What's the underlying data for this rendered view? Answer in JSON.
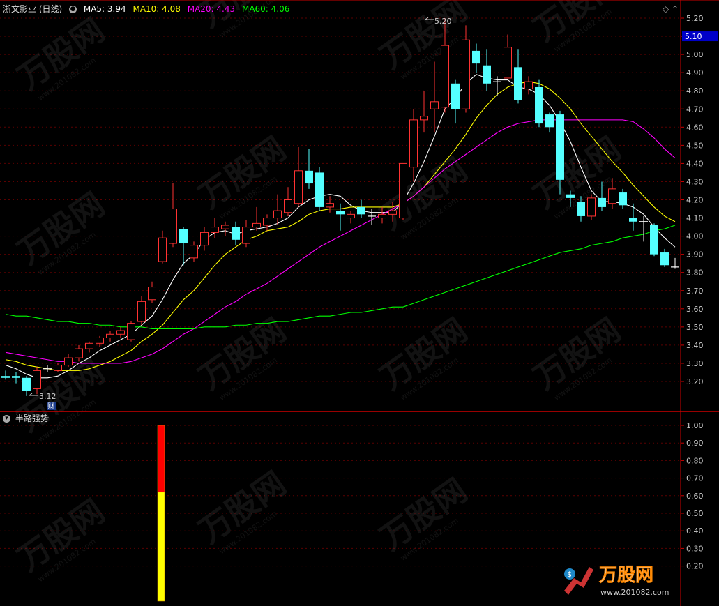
{
  "header": {
    "stock_title": "浙文影业 (日线)",
    "ma5_label": "MA5:",
    "ma5_value": "3.94",
    "ma10_label": "MA10:",
    "ma10_value": "4.08",
    "ma20_label": "MA20:",
    "ma20_value": "4.43",
    "ma60_label": "MA60:",
    "ma60_value": "4.06",
    "colors": {
      "ma5": "#ffffff",
      "ma10": "#ffff00",
      "ma20": "#ff00ff",
      "ma60": "#00ff00"
    }
  },
  "sub_panel": {
    "title": "半路强势"
  },
  "current_price_tag": "5.10",
  "watermark": {
    "brand": "万股网",
    "url": "www.201082.com"
  },
  "chart_data": [
    {
      "type": "candlestick",
      "price_axis": {
        "min": 3.12,
        "max": 5.22,
        "ticks": [
          "5.20",
          "5.10",
          "5.00",
          "4.90",
          "4.80",
          "4.70",
          "4.60",
          "4.50",
          "4.40",
          "4.30",
          "4.20",
          "4.10",
          "4.00",
          "3.90",
          "3.80",
          "3.70",
          "3.60",
          "3.50",
          "3.40",
          "3.30",
          "3.20"
        ]
      },
      "annotations": {
        "high": "5.20",
        "low": "3.12",
        "finance_marker": "财"
      },
      "candles": [
        {
          "o": 3.23,
          "h": 3.26,
          "l": 3.21,
          "c": 3.22
        },
        {
          "o": 3.23,
          "h": 3.25,
          "l": 3.19,
          "c": 3.22
        },
        {
          "o": 3.22,
          "h": 3.23,
          "l": 3.12,
          "c": 3.15
        },
        {
          "o": 3.16,
          "h": 3.28,
          "l": 3.13,
          "c": 3.26
        },
        {
          "o": 3.27,
          "h": 3.29,
          "l": 3.25,
          "c": 3.27
        },
        {
          "o": 3.26,
          "h": 3.3,
          "l": 3.25,
          "c": 3.29
        },
        {
          "o": 3.29,
          "h": 3.35,
          "l": 3.28,
          "c": 3.33
        },
        {
          "o": 3.33,
          "h": 3.4,
          "l": 3.31,
          "c": 3.38
        },
        {
          "o": 3.38,
          "h": 3.42,
          "l": 3.36,
          "c": 3.41
        },
        {
          "o": 3.41,
          "h": 3.45,
          "l": 3.39,
          "c": 3.44
        },
        {
          "o": 3.44,
          "h": 3.48,
          "l": 3.42,
          "c": 3.46
        },
        {
          "o": 3.46,
          "h": 3.5,
          "l": 3.44,
          "c": 3.48
        },
        {
          "o": 3.43,
          "h": 3.53,
          "l": 3.42,
          "c": 3.52
        },
        {
          "o": 3.53,
          "h": 3.67,
          "l": 3.51,
          "c": 3.64
        },
        {
          "o": 3.65,
          "h": 3.75,
          "l": 3.63,
          "c": 3.72
        },
        {
          "o": 3.86,
          "h": 4.03,
          "l": 3.85,
          "c": 3.99
        },
        {
          "o": 3.96,
          "h": 4.29,
          "l": 3.94,
          "c": 4.15
        },
        {
          "o": 4.04,
          "h": 4.05,
          "l": 3.84,
          "c": 3.96
        },
        {
          "o": 3.88,
          "h": 3.97,
          "l": 3.86,
          "c": 3.95
        },
        {
          "o": 3.95,
          "h": 4.05,
          "l": 3.92,
          "c": 4.02
        },
        {
          "o": 4.02,
          "h": 4.1,
          "l": 3.99,
          "c": 4.05
        },
        {
          "o": 4.04,
          "h": 4.08,
          "l": 4.0,
          "c": 4.06
        },
        {
          "o": 4.05,
          "h": 4.08,
          "l": 3.95,
          "c": 3.98
        },
        {
          "o": 3.96,
          "h": 4.09,
          "l": 3.94,
          "c": 4.05
        },
        {
          "o": 4.05,
          "h": 4.16,
          "l": 4.03,
          "c": 4.07
        },
        {
          "o": 4.06,
          "h": 4.12,
          "l": 4.03,
          "c": 4.1
        },
        {
          "o": 4.1,
          "h": 4.23,
          "l": 4.06,
          "c": 4.14
        },
        {
          "o": 4.13,
          "h": 4.27,
          "l": 4.11,
          "c": 4.2
        },
        {
          "o": 4.18,
          "h": 4.49,
          "l": 4.16,
          "c": 4.36
        },
        {
          "o": 4.36,
          "h": 4.48,
          "l": 4.26,
          "c": 4.29
        },
        {
          "o": 4.35,
          "h": 4.38,
          "l": 4.14,
          "c": 4.16
        },
        {
          "o": 4.16,
          "h": 4.22,
          "l": 4.13,
          "c": 4.18
        },
        {
          "o": 4.14,
          "h": 4.18,
          "l": 4.03,
          "c": 4.12
        },
        {
          "o": 4.1,
          "h": 4.14,
          "l": 4.07,
          "c": 4.12
        },
        {
          "o": 4.16,
          "h": 4.2,
          "l": 4.1,
          "c": 4.12
        },
        {
          "o": 4.11,
          "h": 4.15,
          "l": 4.06,
          "c": 4.11
        },
        {
          "o": 4.1,
          "h": 4.16,
          "l": 4.07,
          "c": 4.12
        },
        {
          "o": 4.12,
          "h": 4.19,
          "l": 4.08,
          "c": 4.14
        },
        {
          "o": 4.1,
          "h": 4.4,
          "l": 4.09,
          "c": 4.4
        },
        {
          "o": 4.38,
          "h": 4.7,
          "l": 4.3,
          "c": 4.64
        },
        {
          "o": 4.64,
          "h": 4.8,
          "l": 4.57,
          "c": 4.66
        },
        {
          "o": 4.7,
          "h": 4.96,
          "l": 4.57,
          "c": 4.74
        },
        {
          "o": 4.71,
          "h": 5.2,
          "l": 4.68,
          "c": 5.05
        },
        {
          "o": 4.84,
          "h": 4.86,
          "l": 4.62,
          "c": 4.7
        },
        {
          "o": 4.7,
          "h": 5.16,
          "l": 4.68,
          "c": 5.08
        },
        {
          "o": 5.02,
          "h": 5.06,
          "l": 4.9,
          "c": 4.95
        },
        {
          "o": 4.94,
          "h": 5.03,
          "l": 4.8,
          "c": 4.84
        },
        {
          "o": 4.85,
          "h": 4.88,
          "l": 4.77,
          "c": 4.85
        },
        {
          "o": 4.87,
          "h": 5.11,
          "l": 4.87,
          "c": 5.04
        },
        {
          "o": 4.93,
          "h": 5.03,
          "l": 4.73,
          "c": 4.75
        },
        {
          "o": 4.81,
          "h": 4.88,
          "l": 4.78,
          "c": 4.85
        },
        {
          "o": 4.82,
          "h": 4.86,
          "l": 4.6,
          "c": 4.62
        },
        {
          "o": 4.67,
          "h": 4.68,
          "l": 4.57,
          "c": 4.6
        },
        {
          "o": 4.67,
          "h": 4.69,
          "l": 4.23,
          "c": 4.31
        },
        {
          "o": 4.23,
          "h": 4.25,
          "l": 4.16,
          "c": 4.21
        },
        {
          "o": 4.19,
          "h": 4.22,
          "l": 4.08,
          "c": 4.11
        },
        {
          "o": 4.11,
          "h": 4.23,
          "l": 4.09,
          "c": 4.21
        },
        {
          "o": 4.21,
          "h": 4.3,
          "l": 4.14,
          "c": 4.16
        },
        {
          "o": 4.18,
          "h": 4.32,
          "l": 4.15,
          "c": 4.26
        },
        {
          "o": 4.24,
          "h": 4.26,
          "l": 4.15,
          "c": 4.17
        },
        {
          "o": 4.1,
          "h": 4.18,
          "l": 4.03,
          "c": 4.08
        },
        {
          "o": 4.08,
          "h": 4.11,
          "l": 3.97,
          "c": 4.08
        },
        {
          "o": 4.06,
          "h": 4.07,
          "l": 3.89,
          "c": 3.9
        },
        {
          "o": 3.91,
          "h": 3.93,
          "l": 3.83,
          "c": 3.84
        },
        {
          "o": 3.83,
          "h": 3.88,
          "l": 3.82,
          "c": 3.83
        }
      ],
      "ma_lines": [
        {
          "name": "MA5",
          "color": "#ffffff",
          "values": [
            3.29,
            3.27,
            3.24,
            3.22,
            3.22,
            3.23,
            3.26,
            3.3,
            3.33,
            3.37,
            3.4,
            3.43,
            3.46,
            3.51,
            3.56,
            3.65,
            3.76,
            3.85,
            3.9,
            3.98,
            4.02,
            4.03,
            4.01,
            4.03,
            4.04,
            4.05,
            4.07,
            4.1,
            4.16,
            4.2,
            4.22,
            4.23,
            4.22,
            4.17,
            4.14,
            4.13,
            4.13,
            4.13,
            4.19,
            4.29,
            4.41,
            4.55,
            4.7,
            4.76,
            4.84,
            4.89,
            4.87,
            4.86,
            4.86,
            4.82,
            4.81,
            4.78,
            4.72,
            4.63,
            4.52,
            4.38,
            4.25,
            4.19,
            4.19,
            4.18,
            4.16,
            4.12,
            4.05,
            3.99,
            3.94
          ]
        },
        {
          "name": "MA10",
          "color": "#ffff00",
          "values": [
            3.32,
            3.31,
            3.29,
            3.28,
            3.27,
            3.26,
            3.26,
            3.26,
            3.27,
            3.29,
            3.31,
            3.34,
            3.37,
            3.42,
            3.46,
            3.51,
            3.58,
            3.65,
            3.7,
            3.77,
            3.84,
            3.9,
            3.94,
            3.98,
            4.0,
            4.03,
            4.04,
            4.05,
            4.08,
            4.12,
            4.14,
            4.15,
            4.15,
            4.16,
            4.16,
            4.16,
            4.16,
            4.16,
            4.18,
            4.22,
            4.27,
            4.34,
            4.41,
            4.48,
            4.56,
            4.65,
            4.72,
            4.78,
            4.82,
            4.84,
            4.85,
            4.84,
            4.81,
            4.76,
            4.7,
            4.62,
            4.55,
            4.48,
            4.41,
            4.35,
            4.28,
            4.22,
            4.16,
            4.11,
            4.08
          ]
        },
        {
          "name": "MA20",
          "color": "#ff00ff",
          "values": [
            3.36,
            3.35,
            3.34,
            3.33,
            3.32,
            3.31,
            3.31,
            3.3,
            3.3,
            3.3,
            3.3,
            3.3,
            3.31,
            3.33,
            3.35,
            3.38,
            3.42,
            3.46,
            3.49,
            3.53,
            3.57,
            3.61,
            3.64,
            3.68,
            3.71,
            3.74,
            3.78,
            3.82,
            3.86,
            3.9,
            3.94,
            3.97,
            4.0,
            4.03,
            4.06,
            4.09,
            4.12,
            4.15,
            4.18,
            4.22,
            4.27,
            4.32,
            4.37,
            4.41,
            4.45,
            4.49,
            4.53,
            4.57,
            4.6,
            4.62,
            4.63,
            4.64,
            4.64,
            4.64,
            4.64,
            4.64,
            4.64,
            4.64,
            4.64,
            4.64,
            4.63,
            4.59,
            4.54,
            4.48,
            4.43
          ]
        },
        {
          "name": "MA60",
          "color": "#00ff00",
          "values": [
            3.57,
            3.56,
            3.56,
            3.55,
            3.54,
            3.53,
            3.53,
            3.52,
            3.52,
            3.51,
            3.51,
            3.5,
            3.5,
            3.5,
            3.49,
            3.49,
            3.49,
            3.49,
            3.49,
            3.5,
            3.5,
            3.5,
            3.51,
            3.51,
            3.52,
            3.52,
            3.53,
            3.53,
            3.54,
            3.55,
            3.56,
            3.56,
            3.57,
            3.58,
            3.58,
            3.59,
            3.6,
            3.61,
            3.61,
            3.63,
            3.65,
            3.67,
            3.69,
            3.71,
            3.73,
            3.75,
            3.77,
            3.79,
            3.81,
            3.83,
            3.85,
            3.87,
            3.89,
            3.91,
            3.92,
            3.93,
            3.95,
            3.96,
            3.97,
            3.99,
            4.0,
            4.01,
            4.03,
            4.04,
            4.06
          ]
        }
      ]
    },
    {
      "type": "bar",
      "title": "半路强势",
      "y_axis": {
        "min": 0.0,
        "max": 1.0,
        "ticks": [
          "1.00",
          "0.90",
          "0.80",
          "0.70",
          "0.60",
          "0.50",
          "0.40",
          "0.30",
          "0.20"
        ]
      },
      "signal_index": 13,
      "segments": [
        {
          "name": "red",
          "color": "#ff0000",
          "from": 0.62,
          "to": 1.0
        },
        {
          "name": "yellow",
          "color": "#ffff00",
          "from": 0.0,
          "to": 0.62
        }
      ]
    }
  ]
}
